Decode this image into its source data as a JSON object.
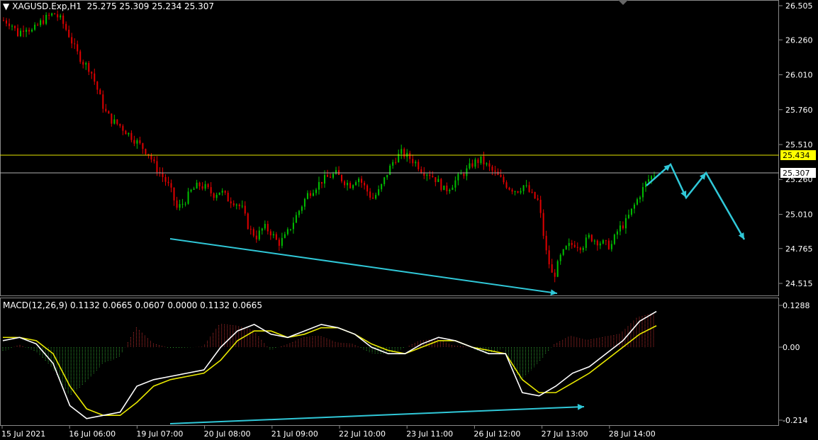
{
  "header": {
    "symbol": "XAGUSD.Exp,H1",
    "ohlc": "25.275 25.309 25.234 25.307"
  },
  "macd_header": "MACD(12,26,9) 0.1132 0.0665 0.0607 0.0000 0.1132 0.0665",
  "price_axis": [
    "26.505",
    "26.260",
    "26.010",
    "25.760",
    "25.510",
    "25.260",
    "25.010",
    "24.765",
    "24.515"
  ],
  "price_tags": {
    "resistance": "25.434",
    "current": "25.307"
  },
  "macd_axis": [
    "0.1288",
    "0.00",
    "-0.214"
  ],
  "time_axis": [
    "15 Jul 2021",
    "16 Jul 06:00",
    "19 Jul 07:00",
    "20 Jul 08:00",
    "21 Jul 09:00",
    "22 Jul 10:00",
    "23 Jul 11:00",
    "26 Jul 12:00",
    "27 Jul 13:00",
    "28 Jul 14:00"
  ],
  "colors": {
    "background": "#000000",
    "bull": "#00c000",
    "bear": "#e00000",
    "resistance_line": "#e6e600",
    "current_line": "#b0b0b0",
    "annotation": "#30c8d8",
    "macd_line": "#ffffff",
    "signal_line": "#e8e800"
  },
  "chart_data": {
    "type": "candlestick",
    "close_series": [
      26.4,
      26.38,
      26.3,
      26.36,
      26.32,
      26.38,
      26.42,
      26.45,
      26.4,
      26.3,
      26.18,
      26.1,
      26.05,
      25.9,
      25.75,
      25.68,
      25.65,
      25.6,
      25.55,
      25.5,
      25.45,
      25.35,
      25.28,
      25.2,
      25.05,
      25.1,
      25.18,
      25.22,
      25.2,
      25.15,
      25.18,
      25.12,
      25.1,
      25.05,
      24.9,
      24.85,
      24.92,
      24.88,
      24.8,
      24.85,
      24.95,
      25.05,
      25.15,
      25.2,
      25.25,
      25.28,
      25.3,
      25.25,
      25.22,
      25.28,
      25.2,
      25.12,
      25.18,
      25.3,
      25.4,
      25.45,
      25.42,
      25.38,
      25.32,
      25.3,
      25.25,
      25.18,
      25.22,
      25.28,
      25.32,
      25.38,
      25.4,
      25.35,
      25.3,
      25.25,
      25.2,
      25.18,
      25.22,
      25.15,
      25.1,
      24.75,
      24.55,
      24.7,
      24.78,
      24.8,
      24.78,
      24.85,
      24.82,
      24.8,
      24.78,
      24.9,
      24.95,
      25.05,
      25.15,
      25.25,
      25.3
    ],
    "resistance": 25.434,
    "current": 25.307,
    "ylim": [
      24.45,
      26.55
    ]
  }
}
